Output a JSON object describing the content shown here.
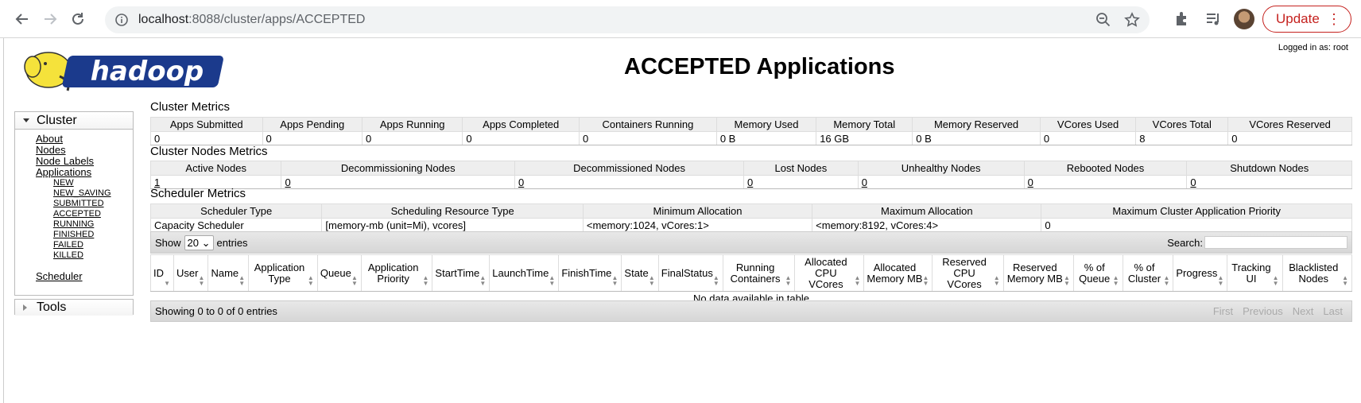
{
  "browser": {
    "url_host": "localhost",
    "url_rest": ":8088/cluster/apps/ACCEPTED",
    "update_label": "Update"
  },
  "header": {
    "logged_in": "Logged in as: root",
    "title": "ACCEPTED Applications",
    "logo_alt": "hadoop"
  },
  "sidebar": {
    "cluster_label": "Cluster",
    "links": [
      "About",
      "Nodes",
      "Node Labels",
      "Applications"
    ],
    "app_states": [
      "NEW",
      "NEW_SAVING",
      "SUBMITTED",
      "ACCEPTED",
      "RUNNING",
      "FINISHED",
      "FAILED",
      "KILLED"
    ],
    "scheduler_label": "Scheduler",
    "tools_label": "Tools"
  },
  "cluster_metrics": {
    "title": "Cluster Metrics",
    "headers": [
      "Apps Submitted",
      "Apps Pending",
      "Apps Running",
      "Apps Completed",
      "Containers Running",
      "Memory Used",
      "Memory Total",
      "Memory Reserved",
      "VCores Used",
      "VCores Total",
      "VCores Reserved"
    ],
    "values": [
      "0",
      "0",
      "0",
      "0",
      "0",
      "0 B",
      "16 GB",
      "0 B",
      "0",
      "8",
      "0"
    ]
  },
  "node_metrics": {
    "title": "Cluster Nodes Metrics",
    "headers": [
      "Active Nodes",
      "Decommissioning Nodes",
      "Decommissioned Nodes",
      "Lost Nodes",
      "Unhealthy Nodes",
      "Rebooted Nodes",
      "Shutdown Nodes"
    ],
    "values": [
      "1",
      "0",
      "0",
      "0",
      "0",
      "0",
      "0"
    ]
  },
  "scheduler_metrics": {
    "title": "Scheduler Metrics",
    "headers": [
      "Scheduler Type",
      "Scheduling Resource Type",
      "Minimum Allocation",
      "Maximum Allocation",
      "Maximum Cluster Application Priority"
    ],
    "values": [
      "Capacity Scheduler",
      "[memory-mb (unit=Mi), vcores]",
      "<memory:1024, vCores:1>",
      "<memory:8192, vCores:4>",
      "0"
    ]
  },
  "table_controls": {
    "show_label": "Show",
    "page_size": "20",
    "entries_label": "entries",
    "search_label": "Search:"
  },
  "apps_table": {
    "columns": [
      "ID",
      "User",
      "Name",
      "Application Type",
      "Queue",
      "Application Priority",
      "StartTime",
      "LaunchTime",
      "FinishTime",
      "State",
      "FinalStatus",
      "Running Containers",
      "Allocated CPU VCores",
      "Allocated Memory MB",
      "Reserved CPU VCores",
      "Reserved Memory MB",
      "% of Queue",
      "% of Cluster",
      "Progress",
      "Tracking UI",
      "Blacklisted Nodes"
    ],
    "empty_message": "No data available in table"
  },
  "footer": {
    "info": "Showing 0 to 0 of 0 entries",
    "pager": [
      "First",
      "Previous",
      "Next",
      "Last"
    ]
  }
}
